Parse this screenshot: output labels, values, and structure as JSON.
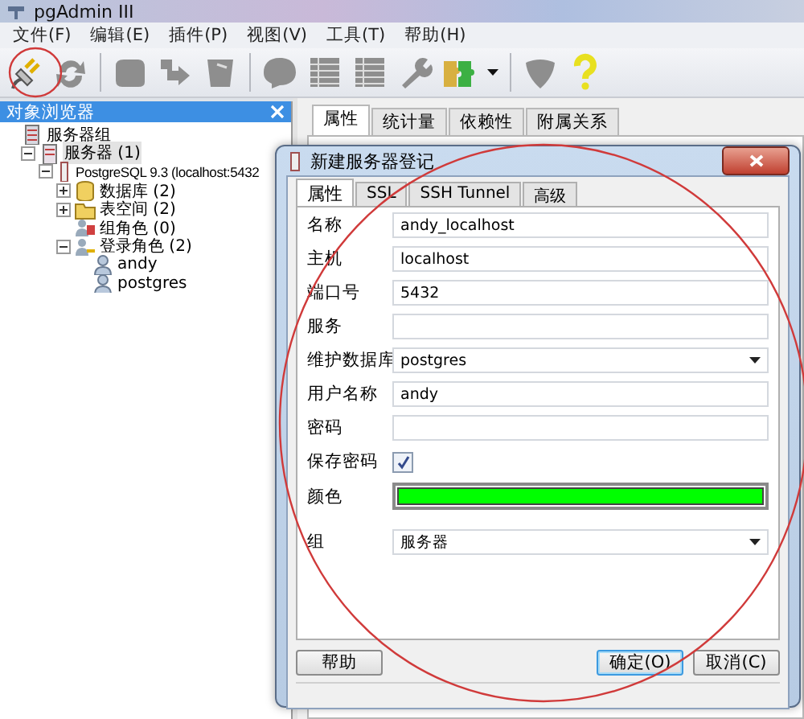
{
  "window": {
    "title": "pgAdmin III"
  },
  "menu": [
    "文件(F)",
    "编辑(E)",
    "插件(P)",
    "视图(V)",
    "工具(T)",
    "帮助(H)"
  ],
  "toolbar": [
    {
      "kind": "connect",
      "disabled": false
    },
    {
      "kind": "refresh",
      "disabled": true
    },
    {
      "kind": "separator"
    },
    {
      "kind": "block",
      "disabled": true
    },
    {
      "kind": "arrow",
      "disabled": true
    },
    {
      "kind": "bin",
      "disabled": true
    },
    {
      "kind": "separator"
    },
    {
      "kind": "bubble",
      "disabled": true
    },
    {
      "kind": "table",
      "disabled": true
    },
    {
      "kind": "table",
      "disabled": true
    },
    {
      "kind": "wrench",
      "disabled": true
    },
    {
      "kind": "puzzle",
      "disabled": false
    },
    {
      "kind": "caret",
      "disabled": false
    },
    {
      "kind": "separator"
    },
    {
      "kind": "shield",
      "disabled": true
    },
    {
      "kind": "help",
      "disabled": false
    }
  ],
  "browser": {
    "title": "对象浏览器",
    "tree": [
      {
        "label": "服务器组",
        "kind": "server-group",
        "selected": false,
        "children": [
          {
            "label": "服务器 (1)",
            "kind": "server",
            "expanded": true,
            "selected": true,
            "children": [
              {
                "label": "PostgreSQL 9.3 (localhost:5432",
                "kind": "db-server",
                "expanded": true,
                "selected": false,
                "children": [
                  {
                    "label": "数据库 (2)",
                    "kind": "database",
                    "expanded": false,
                    "selected": false
                  },
                  {
                    "label": "表空间 (2)",
                    "kind": "tablespace",
                    "expanded": false,
                    "selected": false
                  },
                  {
                    "label": "组角色 (0)",
                    "kind": "group-role",
                    "selected": false
                  },
                  {
                    "label": "登录角色 (2)",
                    "kind": "login-role",
                    "expanded": true,
                    "selected": false,
                    "children": [
                      {
                        "label": "andy",
                        "kind": "user",
                        "selected": false
                      },
                      {
                        "label": "postgres",
                        "kind": "user",
                        "selected": false
                      }
                    ]
                  }
                ]
              }
            ]
          }
        ]
      }
    ]
  },
  "detail": {
    "tabs": [
      {
        "label": "属性",
        "selected": true
      },
      {
        "label": "统计量",
        "selected": false
      },
      {
        "label": "依赖性",
        "selected": false
      },
      {
        "label": "附属关系",
        "selected": false
      }
    ]
  },
  "dialog": {
    "title": "新建服务器登记",
    "tabs": [
      {
        "label": "属性",
        "selected": true
      },
      {
        "label": "SSL",
        "selected": false
      },
      {
        "label": "SSH Tunnel",
        "selected": false
      },
      {
        "label": "高级",
        "selected": false
      }
    ],
    "fields": [
      {
        "label": "名称",
        "kind": "text",
        "value": "andy_localhost"
      },
      {
        "label": "主机",
        "kind": "text",
        "value": "localhost"
      },
      {
        "label": "端口号",
        "kind": "text",
        "value": "5432"
      },
      {
        "label": "服务",
        "kind": "text"
      },
      {
        "label": "维护数据库",
        "kind": "select",
        "value": "postgres"
      },
      {
        "label": "用户名称",
        "kind": "text",
        "value": "andy"
      },
      {
        "label": "密码",
        "kind": "password"
      },
      {
        "label": "保存密码",
        "kind": "checkbox",
        "checked": true
      },
      {
        "label": "颜色",
        "kind": "color",
        "color": "#00ff00"
      },
      {
        "label": "组",
        "kind": "select",
        "value": "服务器"
      }
    ],
    "buttons": [
      {
        "label": "帮助",
        "default": false
      },
      {
        "label": "确定(O)",
        "default": true
      },
      {
        "label": "取消(C)",
        "default": false
      }
    ]
  }
}
